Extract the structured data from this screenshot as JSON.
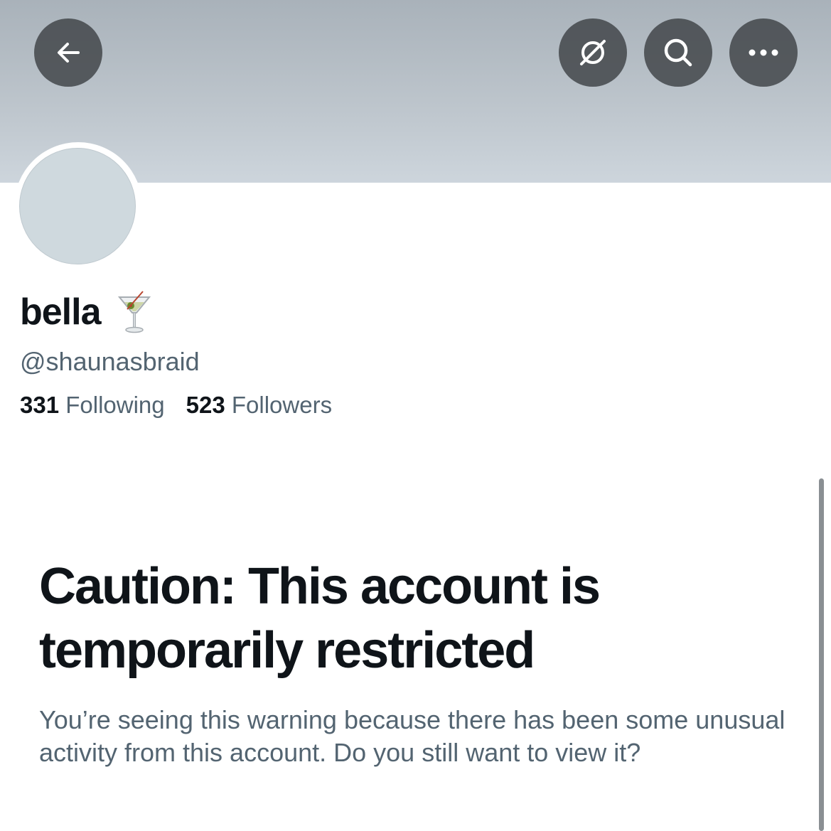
{
  "header": {
    "back_icon": "arrow-left-icon",
    "feed_icon": "crossed-circle-icon",
    "search_icon": "search-icon",
    "more_icon": "more-horizontal-icon",
    "banner_color": "#bcc4cb"
  },
  "profile": {
    "display_name": "bella",
    "name_emoji_icon": "cocktail-glass-icon",
    "handle": "@shaunasbraid",
    "following_count": "331",
    "following_label": "Following",
    "followers_count": "523",
    "followers_label": "Followers",
    "avatar_color": "#cfd9de"
  },
  "warning": {
    "title": "Caution: This account is temporarily restricted",
    "body": "You’re seeing this warning because there has been some unusual activity from this account. Do you still want to view it?"
  }
}
